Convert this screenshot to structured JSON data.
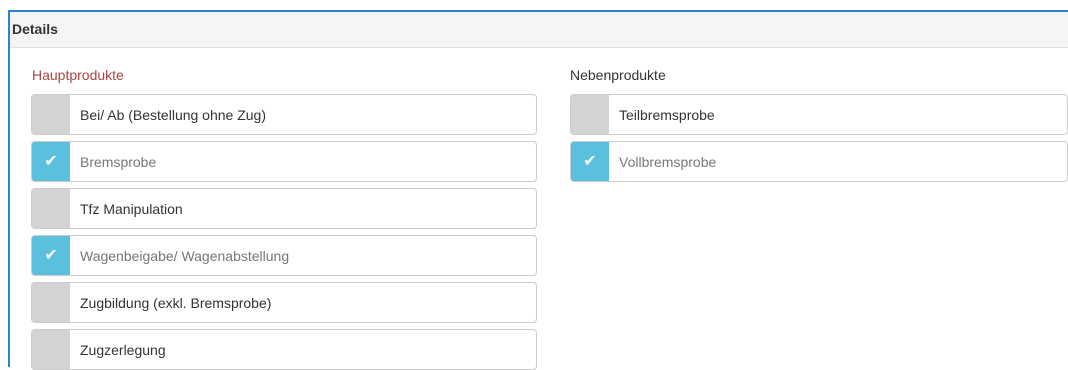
{
  "panel": {
    "title": "Details"
  },
  "groups": {
    "primary": {
      "title": "Hauptprodukte",
      "items": [
        {
          "label": "Bei/ Ab (Bestellung ohne Zug)",
          "checked": false
        },
        {
          "label": "Bremsprobe",
          "checked": true
        },
        {
          "label": "Tfz Manipulation",
          "checked": false
        },
        {
          "label": "Wagenbeigabe/ Wagenabstellung",
          "checked": true
        },
        {
          "label": "Zugbildung (exkl. Bremsprobe)",
          "checked": false
        },
        {
          "label": "Zugzerlegung",
          "checked": false
        }
      ]
    },
    "secondary": {
      "title": "Nebenprodukte",
      "items": [
        {
          "label": "Teilbremsprobe",
          "checked": false
        },
        {
          "label": "Vollbremsprobe",
          "checked": true
        }
      ]
    }
  },
  "check_glyph": "✔",
  "colors": {
    "accent": "#5bc0de",
    "unchecked": "#d3d3d3",
    "border": "#2b86c5",
    "required_title": "#a94442"
  }
}
